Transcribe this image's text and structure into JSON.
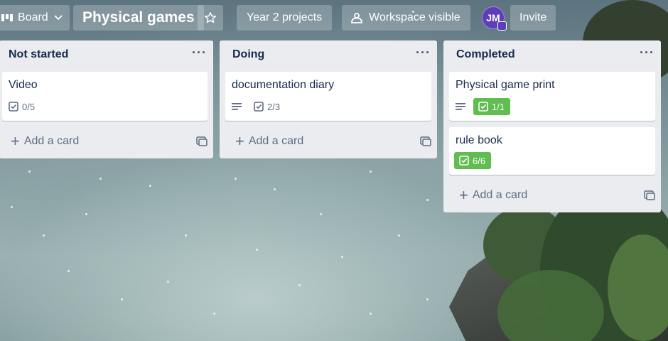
{
  "header": {
    "board_view_label": "Board",
    "board_title": "Physical games",
    "workspace_label": "Year 2 projects",
    "visibility_label": "Workspace visible",
    "avatar_initials": "JM",
    "invite_label": "Invite"
  },
  "lists": [
    {
      "title": "Not started",
      "menu": "···",
      "add_card_label": "Add a card",
      "cards": [
        {
          "title": "Video",
          "checklist": "0/5",
          "has_description": false,
          "complete": false
        }
      ]
    },
    {
      "title": "Doing",
      "menu": "···",
      "add_card_label": "Add a card",
      "cards": [
        {
          "title": "documentation diary",
          "checklist": "2/3",
          "has_description": true,
          "complete": false
        }
      ]
    },
    {
      "title": "Completed",
      "menu": "···",
      "add_card_label": "Add a card",
      "cards": [
        {
          "title": "Physical game print",
          "checklist": "1/1",
          "has_description": true,
          "complete": true
        },
        {
          "title": "rule book",
          "checklist": "6/6",
          "has_description": false,
          "complete": true
        }
      ]
    }
  ],
  "colors": {
    "list_bg": "#ebecf0",
    "complete_badge": "#61bd4f",
    "avatar": "#5e3fb8",
    "text_primary": "#172b4d",
    "text_muted": "#5e6c84"
  }
}
